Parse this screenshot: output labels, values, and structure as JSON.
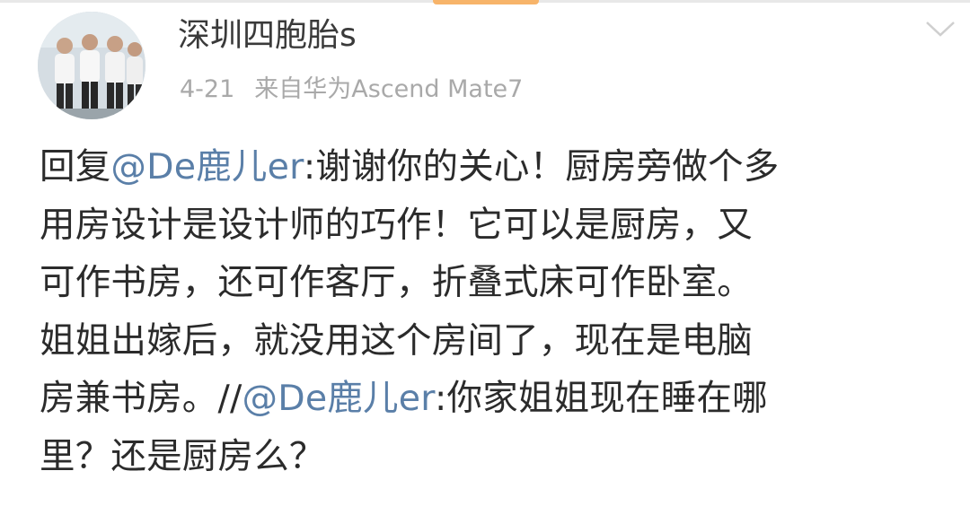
{
  "post": {
    "username": "深圳四胞胎s",
    "date": "4-21",
    "source": "来自华为Ascend Mate7",
    "content": {
      "line1_a": "回复",
      "line1_mention": "@De鹿儿er",
      "line1_b": ":谢谢你的关心！厨房旁做个多",
      "line2": "用房设计是设计师的巧作！它可以是厨房，又",
      "line3": "可作书房，还可作客厅，折叠式床可作卧室。",
      "line4": "姐姐出嫁后，就没用这个房间了，现在是电脑",
      "line5_a": "房兼书房。//",
      "line5_mention": "@De鹿儿er",
      "line5_b": ":你家姐姐现在睡在哪",
      "line6": "里？还是厨房么？"
    }
  },
  "icons": {
    "avatar": "profile-photo-four-children",
    "menu": "chevron-down-icon"
  },
  "colors": {
    "mention": "#5a7fa8",
    "meta": "#a9a9a9",
    "text": "#2b2b2b"
  }
}
